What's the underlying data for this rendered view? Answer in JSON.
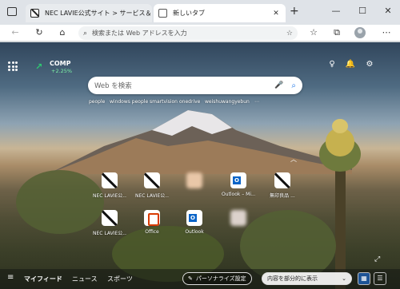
{
  "tabs": [
    {
      "label": "NEC LAVIE公式サイト > サービス＆",
      "close": "✕"
    },
    {
      "label": "新しいタブ",
      "close": "✕"
    }
  ],
  "new_tab_button": "+",
  "window_controls": {
    "minimize": "—",
    "maximize": "☐",
    "close": "✕"
  },
  "address_bar": {
    "placeholder": "検索または Web アドレスを入力"
  },
  "stock": {
    "name": "COMP",
    "change": "+2.25%"
  },
  "search": {
    "placeholder": "Web を検索"
  },
  "trending": [
    "people",
    "windows people",
    "smartvision",
    "onedrive",
    "weishuwangyebun",
    "⋯"
  ],
  "quick_links_row1": [
    "NEC LAVIE公...",
    "NEC LAVIE公...",
    "",
    "Outlook – Mi...",
    "無印良品 ..."
  ],
  "quick_links_row2": [
    "NEC LAVIE公...",
    "Office",
    "Outlook",
    ""
  ],
  "bottom_bar": {
    "menu": "≡",
    "feed": "マイフィード",
    "news": "ニュース",
    "sports": "スポーツ",
    "personalize": "パーソナライズ設定",
    "content_display": "内容を部分的に表示",
    "dropdown": "⌄"
  },
  "colors": {
    "accent": "#1a73e8",
    "stock_up": "#2ecc71"
  }
}
